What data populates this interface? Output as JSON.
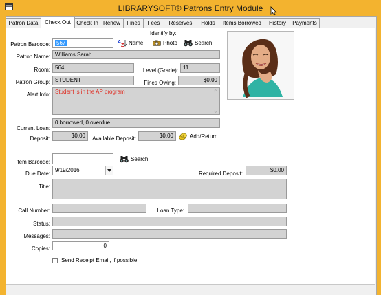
{
  "window": {
    "title": "LIBRARYSOFT® Patrons Entry Module",
    "colors": {
      "frame": "#f3b32f",
      "readonly_field": "#d3d3d3",
      "selection": "#3399ff",
      "alert_text": "#e0261b"
    }
  },
  "tabs": [
    {
      "label": "Patron Data",
      "active": false
    },
    {
      "label": "Check Out",
      "active": true
    },
    {
      "label": "Check In",
      "active": false
    },
    {
      "label": "Renew",
      "active": false
    },
    {
      "label": "Fines",
      "active": false
    },
    {
      "label": "Fees",
      "active": false
    },
    {
      "label": "Reserves",
      "active": false
    },
    {
      "label": "Holds",
      "active": false
    },
    {
      "label": "Items Borrowed",
      "active": false
    },
    {
      "label": "History",
      "active": false
    },
    {
      "label": "Payments",
      "active": false
    }
  ],
  "identify": {
    "heading": "Identify by:",
    "name_label": "Name",
    "photo_label": "Photo",
    "search_label": "Search",
    "icons": [
      "az-sort-icon",
      "camera-icon",
      "binoculars-icon"
    ]
  },
  "patron": {
    "barcode_label": "Patron Barcode:",
    "barcode_value": "567",
    "name_label": "Patron Name:",
    "name_value": "Williams Sarah",
    "room_label": "Room:",
    "room_value": "564",
    "level_label": "Level (Grade):",
    "level_value": "11",
    "group_label": "Patron Group:",
    "group_value": "STUDENT",
    "fines_label": "Fines Owing:",
    "fines_value": "$0.00",
    "alert_label": "Alert Info:",
    "alert_value": "Student is in the AP program",
    "current_loan_label": "Current Loan:",
    "current_loan_value": "0 borrowed, 0 overdue",
    "deposit_label": "Deposit:",
    "deposit_value": "$0.00",
    "available_deposit_label": "Available Deposit:",
    "available_deposit_value": "$0.00",
    "add_return_label": "Add/Return"
  },
  "item": {
    "barcode_label": "Item Barcode:",
    "barcode_value": "",
    "search_label": "Search",
    "due_date_label": "Due Date:",
    "due_date_value": "9/19/2016",
    "required_deposit_label": "Required Deposit:",
    "required_deposit_value": "$0.00",
    "title_label": "Title:",
    "title_value": "",
    "call_number_label": "Call Number:",
    "call_number_value": "",
    "loan_type_label": "Loan Type:",
    "loan_type_value": "",
    "status_label": "Status:",
    "status_value": "",
    "messages_label": "Messages:",
    "messages_value": "",
    "copies_label": "Copies:",
    "copies_value": "0",
    "receipt_email_label": "Send Receipt Email, if possible",
    "receipt_email_checked": false
  }
}
